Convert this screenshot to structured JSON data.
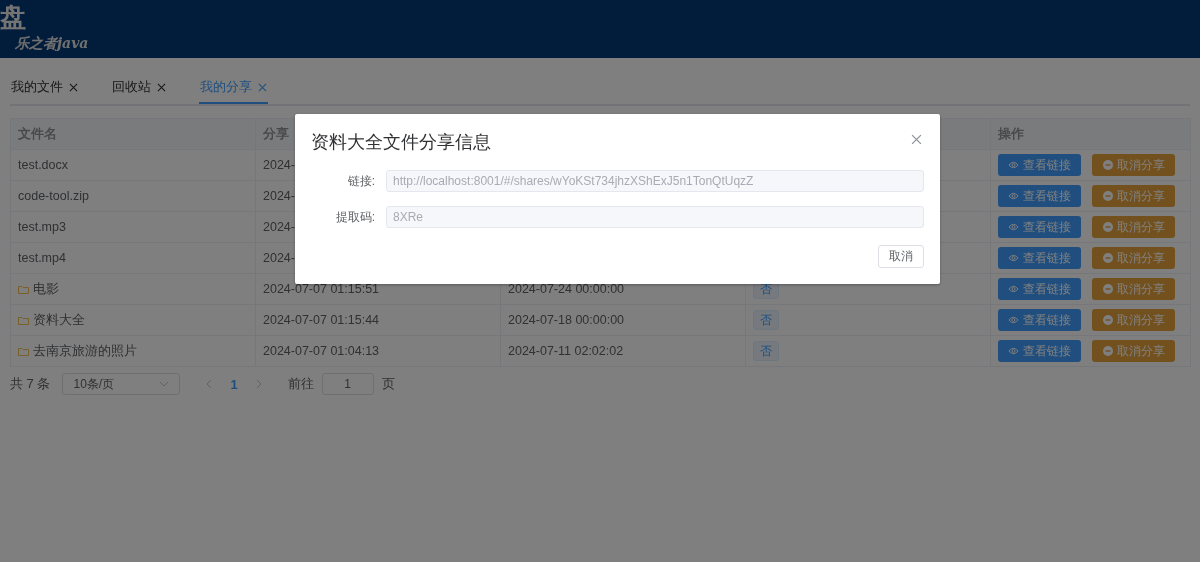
{
  "header": {
    "logo": "盘",
    "subtitle": "乐之者java"
  },
  "tabs": [
    {
      "label": "我的文件",
      "selected": false
    },
    {
      "label": "回收站",
      "selected": false
    },
    {
      "label": "我的分享",
      "selected": true
    }
  ],
  "table": {
    "columns": {
      "file_name": "文件名",
      "column_2": "分享",
      "actions": "操作"
    },
    "rows": [
      {
        "kind": "file",
        "name": "test.docx",
        "column_2": "2024-",
        "view_button": "查看链接",
        "cancel_button": "取消分享"
      },
      {
        "kind": "file",
        "name": "code-tool.zip",
        "column_2": "2024-",
        "view_button": "查看链接",
        "cancel_button": "取消分享"
      },
      {
        "kind": "file",
        "name": "test.mp3",
        "column_2": "2024-",
        "view_button": "查看链接",
        "cancel_button": "取消分享"
      },
      {
        "kind": "file",
        "name": "test.mp4",
        "column_2": "2024-",
        "view_button": "查看链接",
        "cancel_button": "取消分享"
      },
      {
        "kind": "folder",
        "name": "电影",
        "column_2": "2024-07-07 01:15:51",
        "column_3": "2024-07-24 00:00:00",
        "column_4": "否",
        "view_button": "查看链接",
        "cancel_button": "取消分享"
      },
      {
        "kind": "folder",
        "name": "资料大全",
        "column_2": "2024-07-07 01:15:44",
        "column_3": "2024-07-18 00:00:00",
        "column_4": "否",
        "view_button": "查看链接",
        "cancel_button": "取消分享"
      },
      {
        "kind": "folder",
        "name": "去南京旅游的照片",
        "column_2": "2024-07-07 01:04:13",
        "column_3": "2024-07-11 02:02:02",
        "column_4": "否",
        "view_button": "查看链接",
        "cancel_button": "取消分享"
      }
    ]
  },
  "pagination": {
    "total": "共 7 条",
    "page_size": "10条/页",
    "pages": [
      {
        "label": "1",
        "selected": true
      }
    ],
    "goto_prefix": "前往",
    "goto_value": "1",
    "goto_suffix": "页"
  },
  "dialog": {
    "title": "资料大全文件分享信息",
    "fields": [
      {
        "label": "链接:",
        "value": "http://localhost:8001/#/shares/wYoKSt734jhzXShExJ5n1TonQtUqzZ"
      },
      {
        "label": "提取码:",
        "value": "8XRe"
      }
    ],
    "cancel_button": "取消"
  }
}
